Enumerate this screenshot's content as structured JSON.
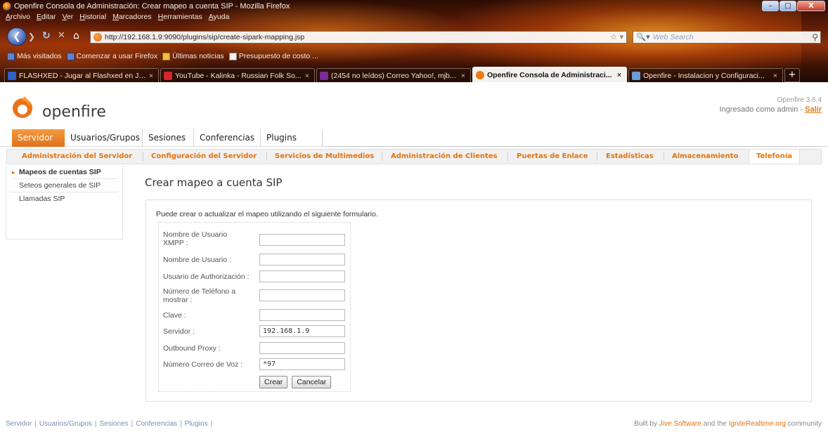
{
  "browser": {
    "window_title": "Openfire Consola de Administración: Crear mapeo a cuenta SIP - Mozilla Firefox",
    "window_controls": [
      "–",
      "□",
      "X"
    ],
    "menu": [
      "Archivo",
      "Editar",
      "Ver",
      "Historial",
      "Marcadores",
      "Herramientas",
      "Ayuda"
    ],
    "url": "http://192.168.1.9:9090/plugins/sip/create-sipark-mapping.jsp",
    "search_placeholder": "Web Search",
    "bookmarks": [
      "Más visitados",
      "Comenzar a usar Firefox",
      "Últimas noticias",
      "Presupuesto de costo ..."
    ],
    "tabs": [
      {
        "title": "FLASHXED - Jugar al Flashxed en Ju...",
        "active": false
      },
      {
        "title": "YouTube - Kalinka - Russian Folk So...",
        "active": false
      },
      {
        "title": "(2454 no leídos) Correo Yahoo!, mjb...",
        "active": false
      },
      {
        "title": "Openfire Consola de Administraci...",
        "active": true
      },
      {
        "title": "Openfire - Instalacion y Configuraci...",
        "active": false
      }
    ],
    "tab_close": "×",
    "new_tab": "+",
    "icons": {
      "back": "back-arrow-icon",
      "forward": "forward-arrow-icon",
      "reload": "reload-icon",
      "stop": "stop-icon",
      "home": "home-icon",
      "bookmark_star": "star-icon",
      "search": "magnifier-icon"
    }
  },
  "openfire": {
    "logo_text": "openfire",
    "version": "Openfire 3.6.4",
    "login_text": "Ingresado como admin - ",
    "logout_label": "Salir",
    "main_tabs": [
      "Servidor",
      "Usuarios/Grupos",
      "Sesiones",
      "Conferencias",
      "Plugins"
    ],
    "active_main_tab": "Servidor",
    "sub_tabs": [
      "Administración del Servidor",
      "Configuración del Servidor",
      "Servicios de Multimedios",
      "Administración de Clientes",
      "Puertas de Enlace",
      "Estadísticas",
      "Almacenamiento",
      "Telefonía"
    ],
    "active_sub_tab": "Telefonía",
    "sidebar": [
      "Mapeos de cuentas SIP",
      "Seteos generales de SIP",
      "Llamadas SIP"
    ],
    "page_title": "Crear mapeo a cuenta SIP",
    "intro": "Puede crear o actualizar el mapeo utilizando el siguiente formulario.",
    "form": {
      "fields": [
        {
          "label": "Nombre de Usuario XMPP :",
          "value": ""
        },
        {
          "label": "Nombre de Usuario :",
          "value": ""
        },
        {
          "label": "Usuario de Authorización :",
          "value": ""
        },
        {
          "label": "Número de Teléfono a mostrar :",
          "value": ""
        },
        {
          "label": "Clave :",
          "value": ""
        },
        {
          "label": "Servidor :",
          "value": "192.168.1.9"
        },
        {
          "label": "Outbound Proxy :",
          "value": ""
        },
        {
          "label": "Número Correo de Voz :",
          "value": "*97"
        }
      ],
      "create_label": "Crear",
      "cancel_label": "Cancelar"
    },
    "footer_links": [
      "Servidor",
      "Usuarios/Grupos",
      "Sesiones",
      "Conferencias",
      "Plugins"
    ],
    "footer_credit": {
      "prefix": "Built by ",
      "jive": "Jive Software",
      "middle": " and the ",
      "ignite": "IgniteRealtime.org",
      "suffix": " community"
    },
    "colors": {
      "accent": "#e07410",
      "active_tab_bg": "#e87f25",
      "link_blue": "#7a8db8"
    }
  }
}
